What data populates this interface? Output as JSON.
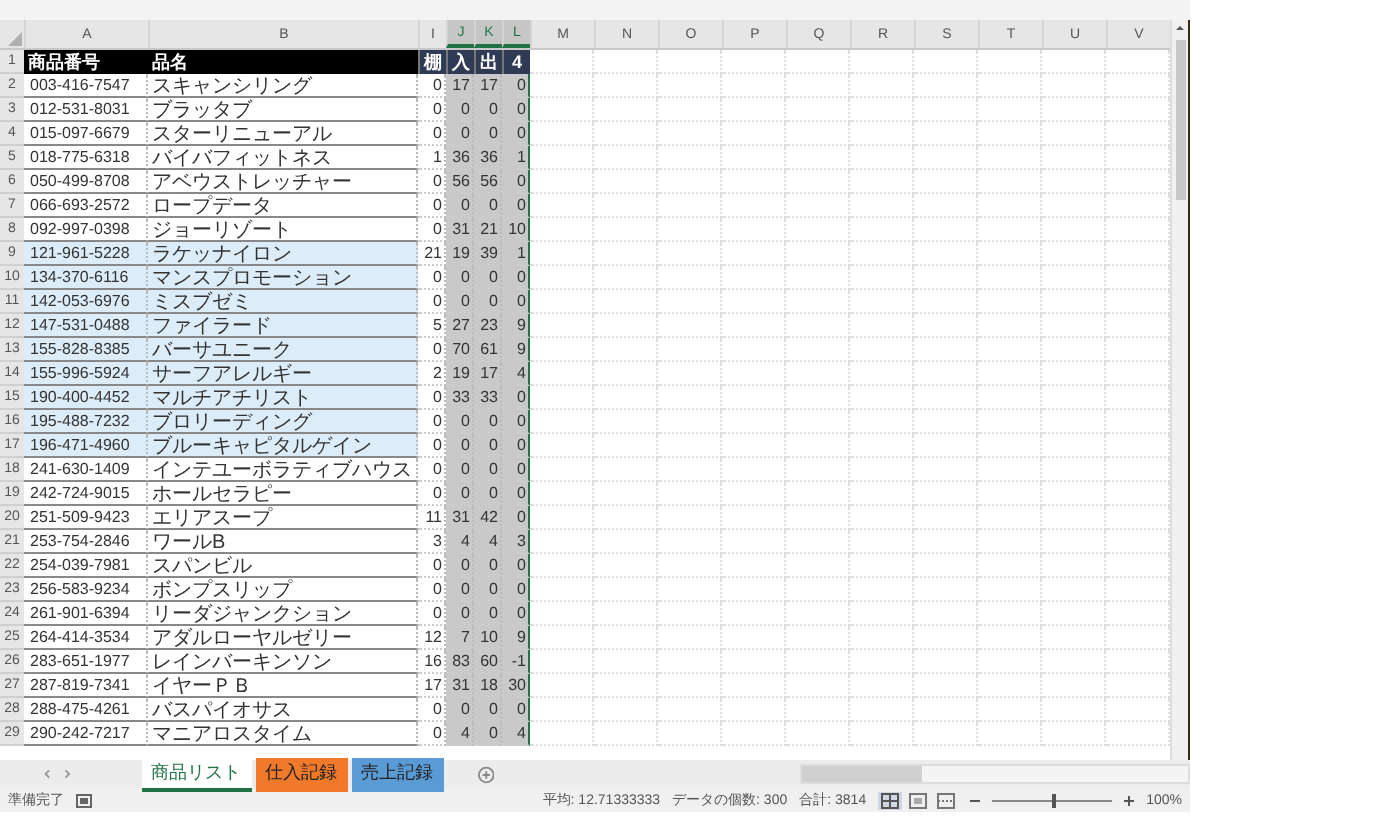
{
  "columns": [
    {
      "letter": "A",
      "selected": false
    },
    {
      "letter": "B",
      "selected": false
    },
    {
      "letter": "I",
      "selected": false
    },
    {
      "letter": "J",
      "selected": true
    },
    {
      "letter": "K",
      "selected": true
    },
    {
      "letter": "L",
      "selected": true
    },
    {
      "letter": "M",
      "selected": false
    },
    {
      "letter": "N",
      "selected": false
    },
    {
      "letter": "O",
      "selected": false
    },
    {
      "letter": "P",
      "selected": false
    },
    {
      "letter": "Q",
      "selected": false
    },
    {
      "letter": "R",
      "selected": false
    },
    {
      "letter": "S",
      "selected": false
    },
    {
      "letter": "T",
      "selected": false
    },
    {
      "letter": "U",
      "selected": false
    },
    {
      "letter": "V",
      "selected": false
    }
  ],
  "header_row": {
    "number": "1",
    "cells": [
      "商品番号",
      "品名",
      "棚",
      "入",
      "出",
      "4"
    ]
  },
  "rows": [
    {
      "number": "2",
      "highlighted": false,
      "cells": [
        "003-416-7547",
        "スキャンシリング",
        "0",
        "17",
        "17",
        "0"
      ]
    },
    {
      "number": "3",
      "highlighted": false,
      "cells": [
        "012-531-8031",
        "ブラッタブ",
        "0",
        "0",
        "0",
        "0"
      ]
    },
    {
      "number": "4",
      "highlighted": false,
      "cells": [
        "015-097-6679",
        "スターリニューアル",
        "0",
        "0",
        "0",
        "0"
      ]
    },
    {
      "number": "5",
      "highlighted": false,
      "cells": [
        "018-775-6318",
        "バイバフィットネス",
        "1",
        "36",
        "36",
        "1"
      ]
    },
    {
      "number": "6",
      "highlighted": false,
      "cells": [
        "050-499-8708",
        "アベウストレッチャー",
        "0",
        "56",
        "56",
        "0"
      ]
    },
    {
      "number": "7",
      "highlighted": false,
      "cells": [
        "066-693-2572",
        "ロープデータ",
        "0",
        "0",
        "0",
        "0"
      ]
    },
    {
      "number": "8",
      "highlighted": false,
      "cells": [
        "092-997-0398",
        "ジョーリゾート",
        "0",
        "31",
        "21",
        "10"
      ]
    },
    {
      "number": "9",
      "highlighted": true,
      "cells": [
        "121-961-5228",
        "ラケッナイロン",
        "21",
        "19",
        "39",
        "1"
      ]
    },
    {
      "number": "10",
      "highlighted": true,
      "cells": [
        "134-370-6116",
        "マンスプロモーション",
        "0",
        "0",
        "0",
        "0"
      ]
    },
    {
      "number": "11",
      "highlighted": true,
      "cells": [
        "142-053-6976",
        "ミスブゼミ",
        "0",
        "0",
        "0",
        "0"
      ]
    },
    {
      "number": "12",
      "highlighted": true,
      "cells": [
        "147-531-0488",
        "ファイラード",
        "5",
        "27",
        "23",
        "9"
      ]
    },
    {
      "number": "13",
      "highlighted": true,
      "cells": [
        "155-828-8385",
        "バーサユニーク",
        "0",
        "70",
        "61",
        "9"
      ]
    },
    {
      "number": "14",
      "highlighted": true,
      "cells": [
        "155-996-5924",
        "サーフアレルギー",
        "2",
        "19",
        "17",
        "4"
      ]
    },
    {
      "number": "15",
      "highlighted": true,
      "cells": [
        "190-400-4452",
        "マルチアチリスト",
        "0",
        "33",
        "33",
        "0"
      ]
    },
    {
      "number": "16",
      "highlighted": true,
      "cells": [
        "195-488-7232",
        "ブロリーディング",
        "0",
        "0",
        "0",
        "0"
      ]
    },
    {
      "number": "17",
      "highlighted": true,
      "cells": [
        "196-471-4960",
        "ブルーキャピタルゲイン",
        "0",
        "0",
        "0",
        "0"
      ]
    },
    {
      "number": "18",
      "highlighted": false,
      "cells": [
        "241-630-1409",
        "インテユーボラティブハウス",
        "0",
        "0",
        "0",
        "0"
      ]
    },
    {
      "number": "19",
      "highlighted": false,
      "cells": [
        "242-724-9015",
        "ホールセラピー",
        "0",
        "0",
        "0",
        "0"
      ]
    },
    {
      "number": "20",
      "highlighted": false,
      "cells": [
        "251-509-9423",
        "エリアスープ",
        "11",
        "31",
        "42",
        "0"
      ]
    },
    {
      "number": "21",
      "highlighted": false,
      "cells": [
        "253-754-2846",
        "ワールB",
        "3",
        "4",
        "4",
        "3"
      ]
    },
    {
      "number": "22",
      "highlighted": false,
      "cells": [
        "254-039-7981",
        "スパンビル",
        "0",
        "0",
        "0",
        "0"
      ]
    },
    {
      "number": "23",
      "highlighted": false,
      "cells": [
        "256-583-9234",
        "ボンプスリップ",
        "0",
        "0",
        "0",
        "0"
      ]
    },
    {
      "number": "24",
      "highlighted": false,
      "cells": [
        "261-901-6394",
        "リーダジャンクション",
        "0",
        "0",
        "0",
        "0"
      ]
    },
    {
      "number": "25",
      "highlighted": false,
      "cells": [
        "264-414-3534",
        "アダルローヤルゼリー",
        "12",
        "7",
        "10",
        "9"
      ]
    },
    {
      "number": "26",
      "highlighted": false,
      "cells": [
        "283-651-1977",
        "レインバーキンソン",
        "16",
        "83",
        "60",
        "-1"
      ]
    },
    {
      "number": "27",
      "highlighted": false,
      "cells": [
        "287-819-7341",
        "イヤーＰＢ",
        "17",
        "31",
        "18",
        "30"
      ]
    },
    {
      "number": "28",
      "highlighted": false,
      "cells": [
        "288-475-4261",
        "バスパイオサス",
        "0",
        "0",
        "0",
        "0"
      ]
    },
    {
      "number": "29",
      "highlighted": false,
      "cells": [
        "290-242-7217",
        "マニアロスタイム",
        "0",
        "4",
        "0",
        "4"
      ]
    }
  ],
  "sheet_tabs": [
    {
      "label": "商品リスト",
      "selected": true,
      "color": "#ffffff"
    },
    {
      "label": "仕入記録",
      "selected": false,
      "color": "#f07a2a"
    },
    {
      "label": "売上記録",
      "selected": false,
      "color": "#5b9bd5"
    }
  ],
  "status_bar": {
    "status": "準備完了",
    "average": "平均: 12.71333333",
    "count": "データの個数: 300",
    "sum": "合計: 3814",
    "zoom": "100%",
    "zoom_slider": {
      "level": 0.5
    }
  }
}
